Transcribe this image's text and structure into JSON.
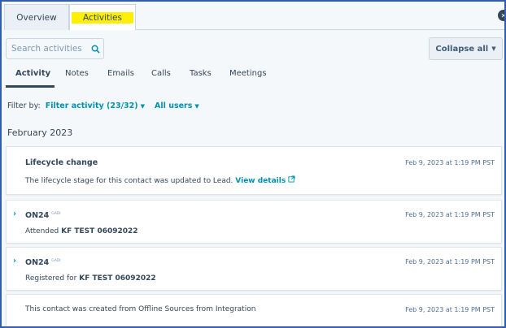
{
  "top_tabs": [
    {
      "label": "Overview"
    },
    {
      "label": "Activities"
    }
  ],
  "search": {
    "placeholder": "Search activities"
  },
  "collapse_label": "Collapse all",
  "sub_tabs": [
    {
      "label": "Activity"
    },
    {
      "label": "Notes"
    },
    {
      "label": "Emails"
    },
    {
      "label": "Calls"
    },
    {
      "label": "Tasks"
    },
    {
      "label": "Meetings"
    }
  ],
  "filter": {
    "prefix": "Filter by:",
    "activity": "Filter activity (23/32)",
    "users": "All users"
  },
  "month": "February 2023",
  "cards": [
    {
      "title": "Lifecycle change",
      "body": "The lifecycle stage for this contact was updated to Lead.",
      "link": "View details",
      "time": "Feb 9, 2023 at 1:19 PM PST"
    },
    {
      "title": "ON24",
      "badge": "GADI",
      "body_prefix": "Attended",
      "body_bold": "KF TEST 06092022",
      "time": "Feb 9, 2023 at 1:19 PM PST"
    },
    {
      "title": "ON24",
      "badge": "GADI",
      "body_prefix": "Registered for",
      "body_bold": "KF TEST 06092022",
      "time": "Feb 9, 2023 at 1:19 PM PST"
    },
    {
      "body": "This contact was created from Offline Sources from Integration",
      "time": "Feb 9, 2023 at 1:19 PM PST"
    }
  ]
}
